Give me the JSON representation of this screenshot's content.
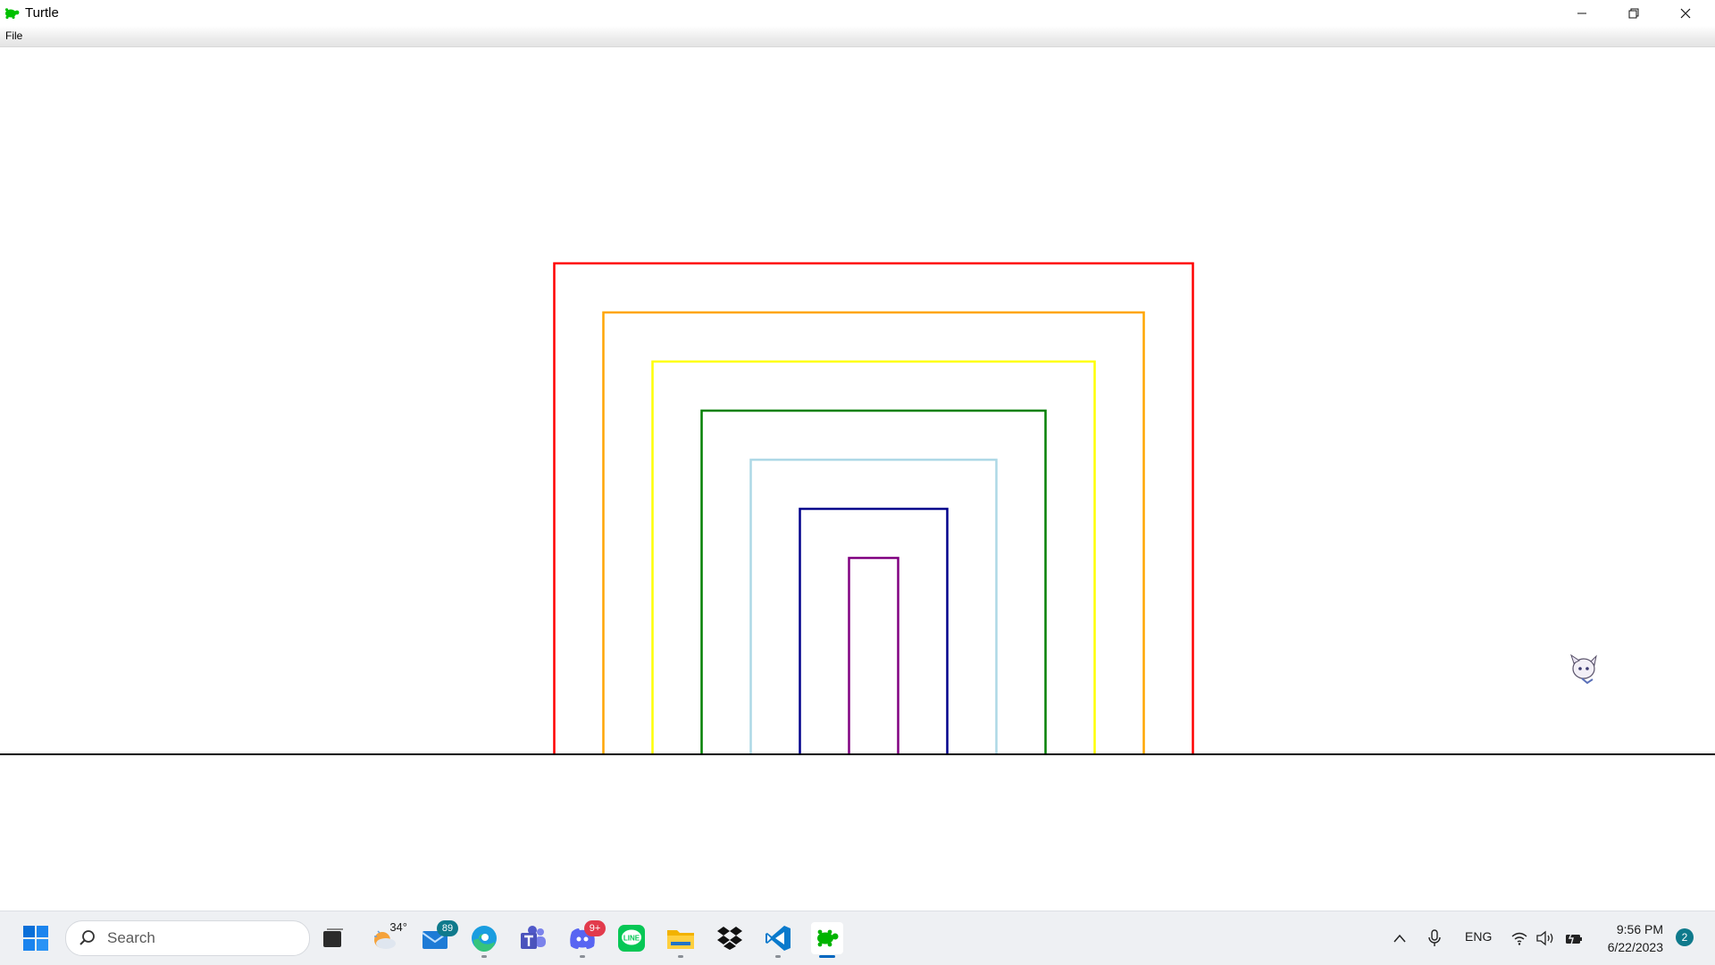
{
  "window": {
    "title": "Turtle"
  },
  "menu": {
    "file_label": "File"
  },
  "canvas": {
    "background": "#ffffff",
    "squares": [
      {
        "color": "#ff0000"
      },
      {
        "color": "#ffa500"
      },
      {
        "color": "#ffff00"
      },
      {
        "color": "#008000"
      },
      {
        "color": "#add8e6"
      },
      {
        "color": "#00008b"
      },
      {
        "color": "#800080"
      }
    ],
    "baseline_color": "#000000"
  },
  "taskbar": {
    "search_placeholder": "Search",
    "weather_temp": "34°",
    "mail_badge": "89",
    "discord_badge": "9+",
    "language": "ENG",
    "time": "9:56 PM",
    "date": "6/22/2023",
    "notification_count": "2",
    "pinned": [
      "start-icon",
      "task-view-icon",
      "weather-icon",
      "mail-icon",
      "edge-icon",
      "teams-icon",
      "discord-icon",
      "line-icon",
      "file-explorer-icon",
      "dropbox-icon",
      "vscode-icon",
      "turtle-app-icon"
    ]
  }
}
